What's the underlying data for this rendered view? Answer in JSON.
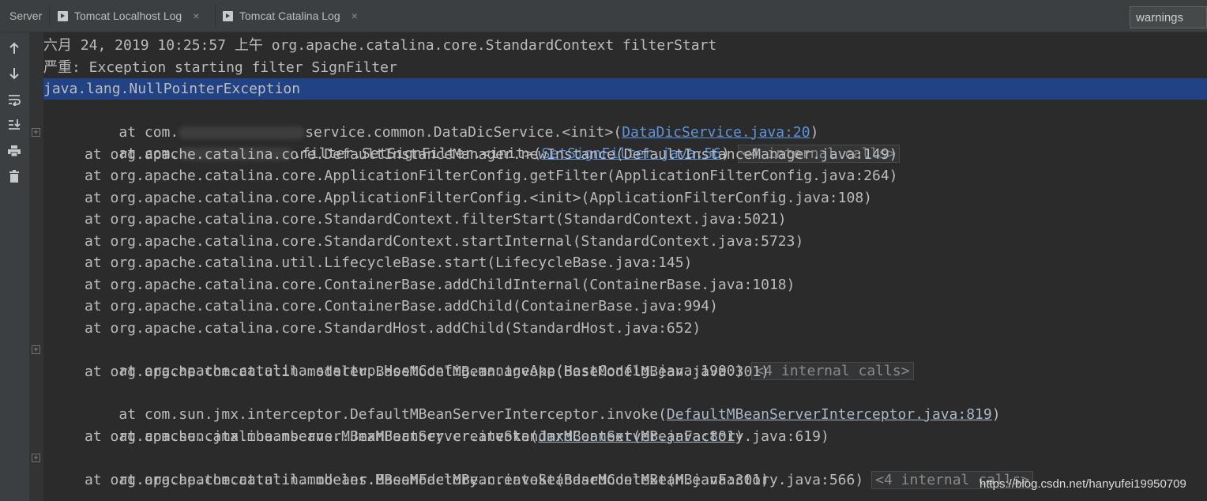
{
  "tabs": {
    "server": "Server",
    "localhost_log": "Tomcat Localhost Log",
    "catalina_log": "Tomcat Catalina Log",
    "close_glyph": "×"
  },
  "filter": {
    "value": "warnings"
  },
  "toolbar": {
    "icons": [
      "up-arrow-icon",
      "down-arrow-icon",
      "soft-wrap-icon",
      "scroll-to-end-icon",
      "print-icon",
      "trash-icon"
    ]
  },
  "log": {
    "l1": "六月 24, 2019 10:25:57 上午 org.apache.catalina.core.StandardContext filterStart",
    "l2": "严重: Exception starting filter SignFilter",
    "l3": "java.lang.NullPointerException",
    "l4_pre": "at com.",
    "l4_mid": "service.common.DataDicService.<init>(",
    "l4_link": "DataDicService.java:20",
    "l4_post": ")",
    "l5_pre": "at com.",
    "l5_mid": ".filter.SetSignFilter.<init>(",
    "l5_link": "SetSignFilter.java:56",
    "l5_post": ")",
    "internal_calls": "<4 internal calls>",
    "l6": "at org.apache.catalina.core.DefaultInstanceManager.newInstance(DefaultInstanceManager.java:149)",
    "l7": "at org.apache.catalina.core.ApplicationFilterConfig.getFilter(ApplicationFilterConfig.java:264)",
    "l8": "at org.apache.catalina.core.ApplicationFilterConfig.<init>(ApplicationFilterConfig.java:108)",
    "l9": "at org.apache.catalina.core.StandardContext.filterStart(StandardContext.java:5021)",
    "l10": "at org.apache.catalina.core.StandardContext.startInternal(StandardContext.java:5723)",
    "l11": "at org.apache.catalina.util.LifecycleBase.start(LifecycleBase.java:145)",
    "l12": "at org.apache.catalina.core.ContainerBase.addChildInternal(ContainerBase.java:1018)",
    "l13": "at org.apache.catalina.core.ContainerBase.addChild(ContainerBase.java:994)",
    "l14": "at org.apache.catalina.core.StandardHost.addChild(StandardHost.java:652)",
    "l15": "at org.apache.catalina.startup.HostConfig.manageApp(HostConfig.java:1900)",
    "l16": "at org.apache.tomcat.util.modeler.BaseModelMBean.invoke(BaseModelMBean.java:301)",
    "l17_pre": "at com.sun.jmx.interceptor.DefaultMBeanServerInterceptor.invoke(",
    "l17_link": "DefaultMBeanServerInterceptor.java:819",
    "l17_post": ")",
    "l18_pre": "at com.sun.jmx.mbeanserver.JmxMBeanServer.invoke(",
    "l18_link": "JmxMBeanServer.java:801",
    "l18_post": ")",
    "l19": "at org.apache.catalina.mbeans.MBeanFactory.createStandardContext(MBeanFactory.java:619)",
    "l20": "at org.apache.catalina.mbeans.MBeanFactory.createStandardContext(MBeanFactory.java:566)",
    "l21": "at org.apache.tomcat.util.modeler.BaseModelMBean.invoke(BaseModelMBean.java:301)"
  },
  "watermark": "https://blog.csdn.net/hanyufei19950709"
}
